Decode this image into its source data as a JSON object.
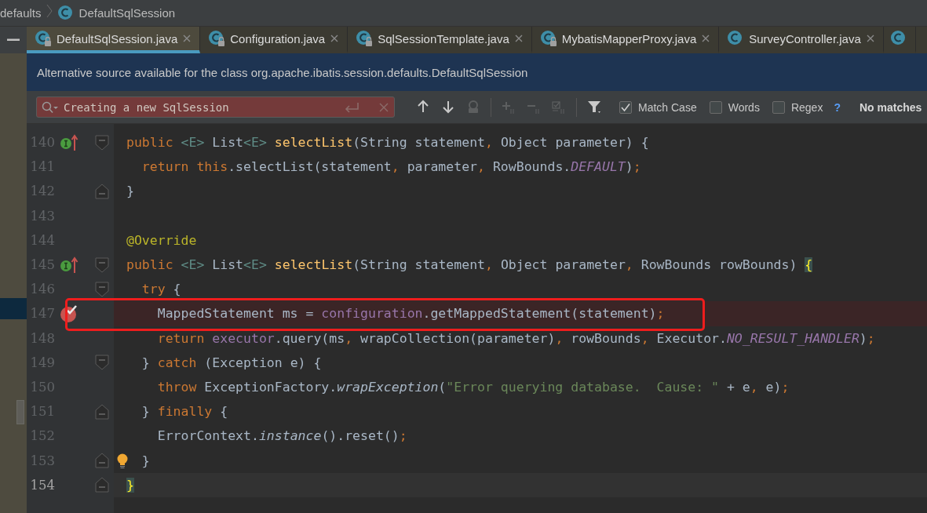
{
  "breadcrumbs": [
    {
      "label": "defaults",
      "kind": "package"
    },
    {
      "label": "DefaultSqlSession",
      "kind": "class"
    }
  ],
  "tabs": [
    {
      "label": "DefaultSqlSession.java",
      "selected": true,
      "locked": true
    },
    {
      "label": "Configuration.java",
      "selected": false,
      "locked": true
    },
    {
      "label": "SqlSessionTemplate.java",
      "selected": false,
      "locked": true
    },
    {
      "label": "MybatisMapperProxy.java",
      "selected": false,
      "locked": true
    },
    {
      "label": "SurveyController.java",
      "selected": false,
      "locked": false
    }
  ],
  "banner": {
    "text": "Alternative source available for the class org.apache.ibatis.session.defaults.DefaultSqlSession"
  },
  "find_bar": {
    "value": "Creating a new SqlSession",
    "no_match": true,
    "tools": [
      {
        "kind": "prev",
        "disabled": false
      },
      {
        "kind": "next",
        "disabled": false
      },
      {
        "kind": "find_all",
        "disabled": true
      },
      {
        "kind": "sep"
      },
      {
        "kind": "add",
        "disabled": true
      },
      {
        "kind": "remove",
        "disabled": true
      },
      {
        "kind": "select_all",
        "disabled": true
      },
      {
        "kind": "sep"
      },
      {
        "kind": "filter",
        "disabled": false
      }
    ],
    "options": [
      {
        "label": "Match Case",
        "checked": true
      },
      {
        "label": "Words",
        "checked": false
      },
      {
        "label": "Regex",
        "checked": false
      }
    ],
    "help": "?",
    "status": "No matches"
  },
  "editor": {
    "lines": [
      {
        "number": "140",
        "fold": {
          "kind": "start"
        },
        "gutter": {
          "kind": "implements"
        },
        "breakpoint": false,
        "current": false,
        "boxed": false,
        "tokens": [
          {
            "kind": "kw",
            "text": "public"
          },
          {
            "kind": "gen",
            "text": " <E>"
          },
          {
            "kind": "plain",
            "text": " List"
          },
          {
            "kind": "gen",
            "text": "<E>"
          },
          {
            "kind": "method",
            "text": " selectList"
          },
          {
            "kind": "plain",
            "text": "(String statement"
          },
          {
            "kind": "punct",
            "text": ","
          },
          {
            "kind": "plain",
            "text": " Object parameter) {"
          }
        ]
      },
      {
        "number": "141",
        "breakpoint": false,
        "current": false,
        "boxed": false,
        "tokens": [
          {
            "kind": "kw",
            "text": "  return this"
          },
          {
            "kind": "plain",
            "text": ".selectList(statement"
          },
          {
            "kind": "punct",
            "text": ","
          },
          {
            "kind": "plain",
            "text": " parameter"
          },
          {
            "kind": "punct",
            "text": ","
          },
          {
            "kind": "plain",
            "text": " RowBounds."
          },
          {
            "kind": "const",
            "text": "DEFAULT"
          },
          {
            "kind": "plain",
            "text": ")"
          },
          {
            "kind": "punct",
            "text": ";"
          }
        ]
      },
      {
        "number": "142",
        "fold": {
          "kind": "end"
        },
        "breakpoint": false,
        "current": false,
        "boxed": false,
        "tokens": [
          {
            "kind": "plain",
            "text": "}"
          }
        ]
      },
      {
        "number": "143",
        "breakpoint": false,
        "current": false,
        "boxed": false
      },
      {
        "number": "144",
        "breakpoint": false,
        "current": false,
        "boxed": false,
        "tokens": [
          {
            "kind": "ann",
            "text": "@Override"
          }
        ]
      },
      {
        "number": "145",
        "fold": {
          "kind": "start"
        },
        "gutter": {
          "kind": "implements"
        },
        "breakpoint": false,
        "current": false,
        "boxed": false,
        "tokens": [
          {
            "kind": "kw",
            "text": "public"
          },
          {
            "kind": "gen",
            "text": " <E>"
          },
          {
            "kind": "plain",
            "text": " List"
          },
          {
            "kind": "gen",
            "text": "<E>"
          },
          {
            "kind": "method",
            "text": " selectList"
          },
          {
            "kind": "plain",
            "text": "(String statement"
          },
          {
            "kind": "punct",
            "text": ","
          },
          {
            "kind": "plain",
            "text": " Object parameter"
          },
          {
            "kind": "punct",
            "text": ","
          },
          {
            "kind": "plain",
            "text": " RowBounds rowBounds) "
          },
          {
            "kind": "brace",
            "text": "{"
          }
        ]
      },
      {
        "number": "146",
        "fold": {
          "kind": "start"
        },
        "breakpoint": false,
        "current": false,
        "boxed": false,
        "tokens": [
          {
            "kind": "kw",
            "text": "  try"
          },
          {
            "kind": "plain",
            "text": " {"
          }
        ]
      },
      {
        "number": "147",
        "breakpoint": true,
        "current": false,
        "boxed": true,
        "tokens": [
          {
            "kind": "plain",
            "text": "    MappedStatement ms = "
          },
          {
            "kind": "field",
            "text": "configuration"
          },
          {
            "kind": "plain",
            "text": ".getMappedStatement(statement)"
          },
          {
            "kind": "punct",
            "text": ";"
          }
        ]
      },
      {
        "number": "148",
        "breakpoint": false,
        "current": false,
        "boxed": false,
        "tokens": [
          {
            "kind": "kw",
            "text": "    return"
          },
          {
            "kind": "field",
            "text": " executor"
          },
          {
            "kind": "plain",
            "text": ".query(ms"
          },
          {
            "kind": "punct",
            "text": ","
          },
          {
            "kind": "plain",
            "text": " wrapCollection(parameter)"
          },
          {
            "kind": "punct",
            "text": ","
          },
          {
            "kind": "plain",
            "text": " rowBounds"
          },
          {
            "kind": "punct",
            "text": ","
          },
          {
            "kind": "plain",
            "text": " Executor."
          },
          {
            "kind": "const",
            "text": "NO_RESULT_HANDLER"
          },
          {
            "kind": "plain",
            "text": ")"
          },
          {
            "kind": "punct",
            "text": ";"
          }
        ]
      },
      {
        "number": "149",
        "fold": {
          "kind": "start"
        },
        "breakpoint": false,
        "current": false,
        "boxed": false,
        "tokens": [
          {
            "kind": "plain",
            "text": "  }"
          },
          {
            "kind": "kw",
            "text": " catch"
          },
          {
            "kind": "plain",
            "text": " (Exception e) {"
          }
        ]
      },
      {
        "number": "150",
        "breakpoint": false,
        "current": false,
        "boxed": false,
        "tokens": [
          {
            "kind": "kw",
            "text": "    throw"
          },
          {
            "kind": "plain",
            "text": " ExceptionFactory."
          },
          {
            "kind": "italic",
            "text": "wrapException"
          },
          {
            "kind": "plain",
            "text": "("
          },
          {
            "kind": "string",
            "text": "\"Error querying database.  Cause: \""
          },
          {
            "kind": "plain",
            "text": " + e"
          },
          {
            "kind": "punct",
            "text": ","
          },
          {
            "kind": "plain",
            "text": " e)"
          },
          {
            "kind": "punct",
            "text": ";"
          }
        ]
      },
      {
        "number": "151",
        "fold": {
          "kind": "end"
        },
        "breakpoint": false,
        "current": false,
        "boxed": false,
        "tokens": [
          {
            "kind": "plain",
            "text": "  }"
          },
          {
            "kind": "kw",
            "text": " finally"
          },
          {
            "kind": "plain",
            "text": " {"
          }
        ]
      },
      {
        "number": "152",
        "breakpoint": false,
        "current": false,
        "boxed": false,
        "tokens": [
          {
            "kind": "plain",
            "text": "    ErrorContext."
          },
          {
            "kind": "italic",
            "text": "instance"
          },
          {
            "kind": "plain",
            "text": "().reset()"
          },
          {
            "kind": "punct",
            "text": ";"
          }
        ]
      },
      {
        "number": "153",
        "fold": {
          "kind": "end"
        },
        "gutter": {
          "kind": "bulb"
        },
        "breakpoint": false,
        "current": false,
        "boxed": false,
        "tokens": [
          {
            "kind": "plain",
            "text": "  }"
          }
        ]
      },
      {
        "number": "154",
        "fold": {
          "kind": "end"
        },
        "breakpoint": false,
        "current": true,
        "boxed": false,
        "tokens": [
          {
            "kind": "brace",
            "text": "}"
          }
        ]
      }
    ]
  }
}
